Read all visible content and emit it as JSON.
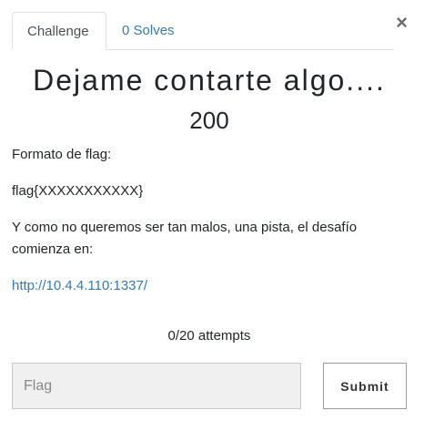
{
  "close_icon": "×",
  "tabs": [
    {
      "label": "Challenge"
    },
    {
      "label": "0 Solves"
    }
  ],
  "challenge": {
    "title": "Dejame contarte algo....",
    "points": "200",
    "description": {
      "line1": "Formato de flag:",
      "line2": "flag{XXXXXXXXXXX}",
      "line3": "Y como no queremos ser tan malos, una pista, el desafío comienza en:",
      "link": "http://10.4.4.110:1337/"
    },
    "attempts": "0/20 attempts"
  },
  "submission": {
    "placeholder": "Flag",
    "submit_label": "Submit"
  },
  "colors": {
    "link": "#337ab7",
    "text": "#212529",
    "input_bg": "#f0f0f0"
  }
}
